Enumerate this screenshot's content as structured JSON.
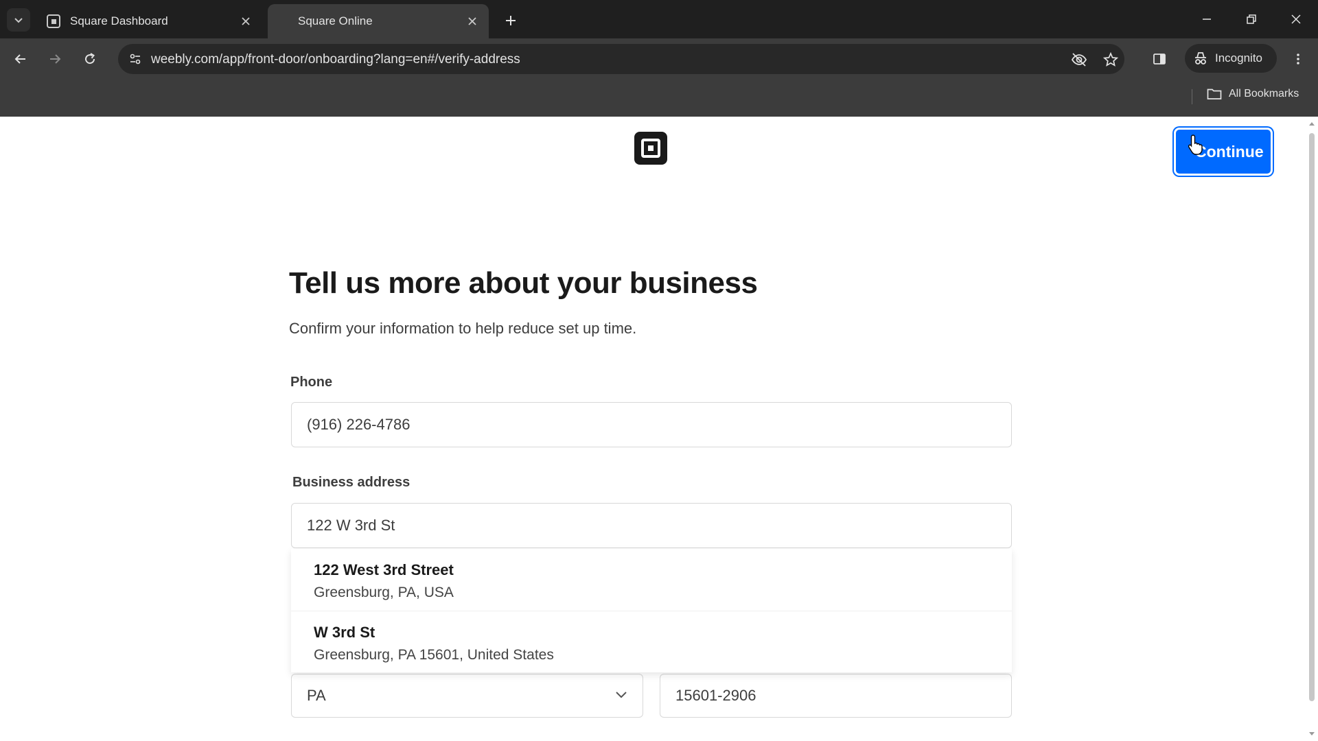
{
  "browser": {
    "tabs": [
      {
        "title": "Square Dashboard",
        "active": false
      },
      {
        "title": "Square Online",
        "active": true
      }
    ],
    "url": "weebly.com/app/front-door/onboarding?lang=en#/verify-address",
    "incognito_label": "Incognito",
    "bookmarks_label": "All Bookmarks"
  },
  "page": {
    "continue_label": "Continue",
    "heading": "Tell us more about your business",
    "subheading": "Confirm your information to help reduce set up time.",
    "phone": {
      "label": "Phone",
      "value": "(916) 226-4786"
    },
    "address": {
      "label": "Business address",
      "value": "122 W 3rd St"
    },
    "suggestions": [
      {
        "main": "122 West 3rd Street",
        "secondary": "Greensburg, PA, USA"
      },
      {
        "main": "W 3rd St",
        "secondary": "Greensburg, PA 15601, United States"
      }
    ],
    "state": {
      "value": "PA"
    },
    "zip": {
      "value": "15601-2906"
    }
  },
  "colors": {
    "accent": "#006aff",
    "chrome_dark": "#1f1f1f",
    "chrome_toolbar": "#3c3c3c"
  },
  "icons": [
    "tab-search-icon",
    "square-favicon-icon",
    "close-icon",
    "plus-icon",
    "minimize-icon",
    "restore-icon",
    "back-arrow-icon",
    "forward-arrow-icon",
    "reload-icon",
    "site-settings-icon",
    "eye-off-icon",
    "star-icon",
    "side-panel-icon",
    "incognito-icon",
    "more-vert-icon",
    "folder-icon",
    "square-logo-icon",
    "chevron-down-icon",
    "cursor-pointer-icon"
  ]
}
